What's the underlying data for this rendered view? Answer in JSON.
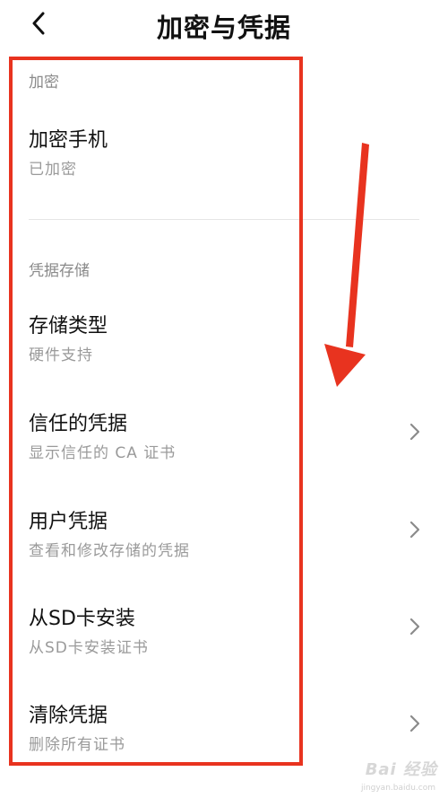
{
  "header": {
    "title": "加密与凭据",
    "back_icon": "chevron-left-icon"
  },
  "sections": {
    "encryption": {
      "header": "加密",
      "items": [
        {
          "title": "加密手机",
          "subtitle": "已加密"
        }
      ]
    },
    "credential_storage": {
      "header": "凭据存储",
      "items": [
        {
          "title": "存储类型",
          "subtitle": "硬件支持"
        },
        {
          "title": "信任的凭据",
          "subtitle": "显示信任的 CA 证书"
        },
        {
          "title": "用户凭据",
          "subtitle": "查看和修改存储的凭据"
        },
        {
          "title": "从SD卡安装",
          "subtitle": "从SD卡安装证书"
        },
        {
          "title": "清除凭据",
          "subtitle": "删除所有证书"
        }
      ]
    }
  },
  "annotation": {
    "box_color": "#e8331f",
    "arrow_color": "#e8331f"
  },
  "watermark": {
    "text": "Bai 经验",
    "sub": "jingyan.baidu.com"
  },
  "colors": {
    "title_text": "#111111",
    "secondary_text": "#9a9a9a",
    "section_header": "#8a8a8a",
    "divider": "#e6e6e6"
  }
}
